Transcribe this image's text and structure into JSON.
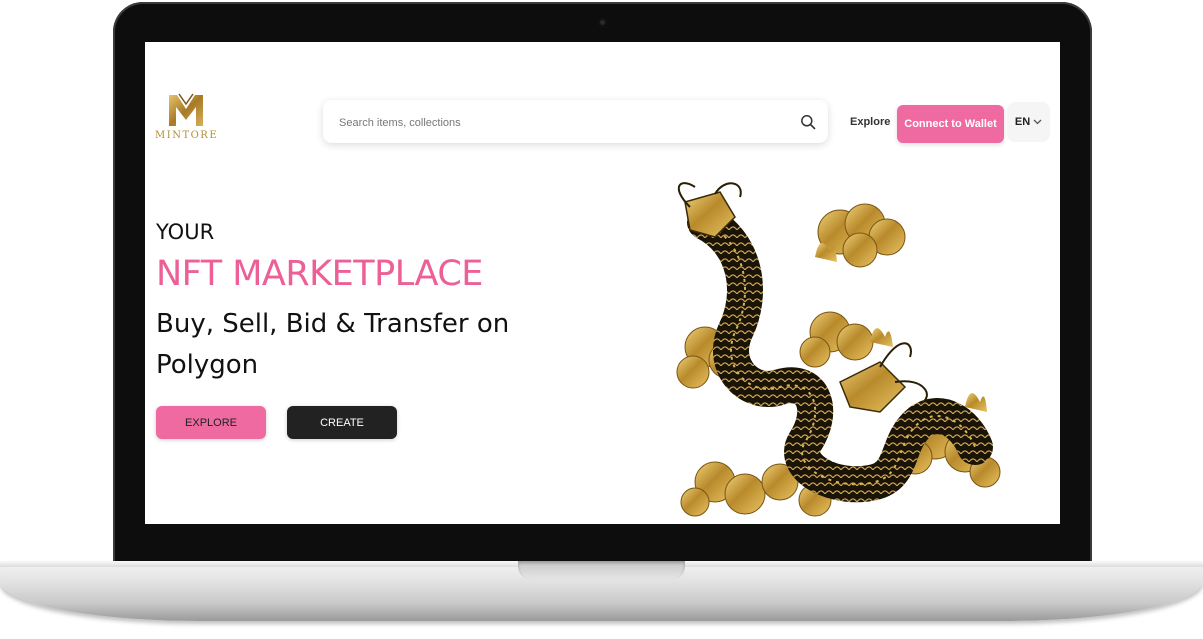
{
  "header": {
    "logo_text": "MINTORE",
    "search_placeholder": "Search items, collections",
    "nav_explore": "Explore",
    "connect_wallet": "Connect to Wallet",
    "language": "EN"
  },
  "hero": {
    "line1": "YOUR",
    "title": "NFT MARKETPLACE",
    "subtitle": "Buy, Sell, Bid & Transfer on Polygon",
    "explore_button": "EXPLORE",
    "create_button": "CREATE"
  },
  "colors": {
    "accent_pink": "#ef6aa1",
    "gold": "#b48e3c",
    "dark_button": "#222222"
  },
  "icons": [
    "search-icon",
    "chevron-down-icon",
    "mintore-logo-icon",
    "dragon-illustration"
  ]
}
